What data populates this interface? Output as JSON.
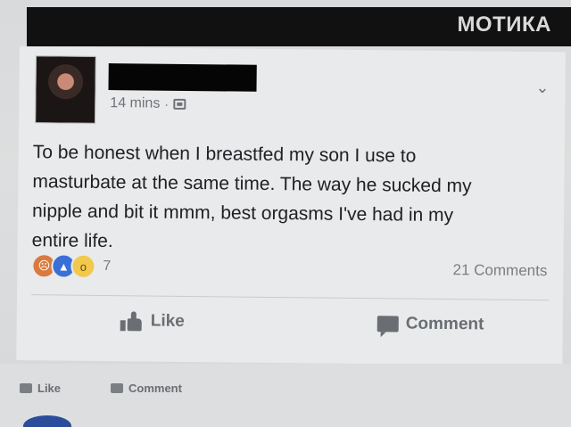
{
  "watermark": "МОТИКА",
  "post": {
    "timestamp": "14 mins",
    "separator": "·",
    "privacy_icon": "globe-icon",
    "menu_icon": "chevron-down-icon",
    "text": "To be honest when I breastfed my son I use to\nmasturbate at the same time. The way he sucked my\nnipple and bit it mmm, best orgasms I've had in my\nentire life.",
    "reaction_icons": [
      "angry-icon",
      "like-icon",
      "wow-icon"
    ],
    "reaction_count": "7",
    "comments_count": "21 Comments",
    "actions": {
      "like_label": "Like",
      "comment_label": "Comment"
    }
  },
  "next_post": {
    "actions": {
      "like_label": "Like",
      "comment_label": "Comment"
    }
  },
  "colors": {
    "text": "#202124",
    "meta": "#6f7377",
    "card": "#e9eaec",
    "redaction": "#050505"
  }
}
